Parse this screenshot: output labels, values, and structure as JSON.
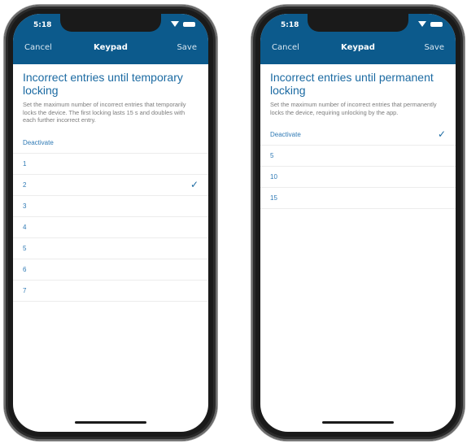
{
  "left": {
    "status_time": "5:18",
    "nav": {
      "cancel": "Cancel",
      "title": "Keypad",
      "save": "Save"
    },
    "title": "Incorrect entries until temporary locking",
    "description": "Set the maximum number of incorrect entries that temporarily locks the device. The first locking lasts 15 s and doubles with each further incorrect entry.",
    "options": [
      {
        "label": "Deactivate",
        "selected": false
      },
      {
        "label": "1",
        "selected": false
      },
      {
        "label": "2",
        "selected": true
      },
      {
        "label": "3",
        "selected": false
      },
      {
        "label": "4",
        "selected": false
      },
      {
        "label": "5",
        "selected": false
      },
      {
        "label": "6",
        "selected": false
      },
      {
        "label": "7",
        "selected": false
      }
    ],
    "check_icon": "✓"
  },
  "right": {
    "status_time": "5:18",
    "nav": {
      "cancel": "Cancel",
      "title": "Keypad",
      "save": "Save"
    },
    "title": "Incorrect entries until permanent locking",
    "description": "Set the maximum number of incorrect entries that permanently locks the device, requiring unlocking by the app.",
    "options": [
      {
        "label": "Deactivate",
        "selected": true
      },
      {
        "label": "5",
        "selected": false
      },
      {
        "label": "10",
        "selected": false
      },
      {
        "label": "15",
        "selected": false
      }
    ],
    "check_icon": "✓"
  },
  "colors": {
    "header": "#0c5a8c",
    "accent": "#1b6aa2",
    "option_text": "#2f7ab5",
    "description": "#7c7c7c"
  }
}
